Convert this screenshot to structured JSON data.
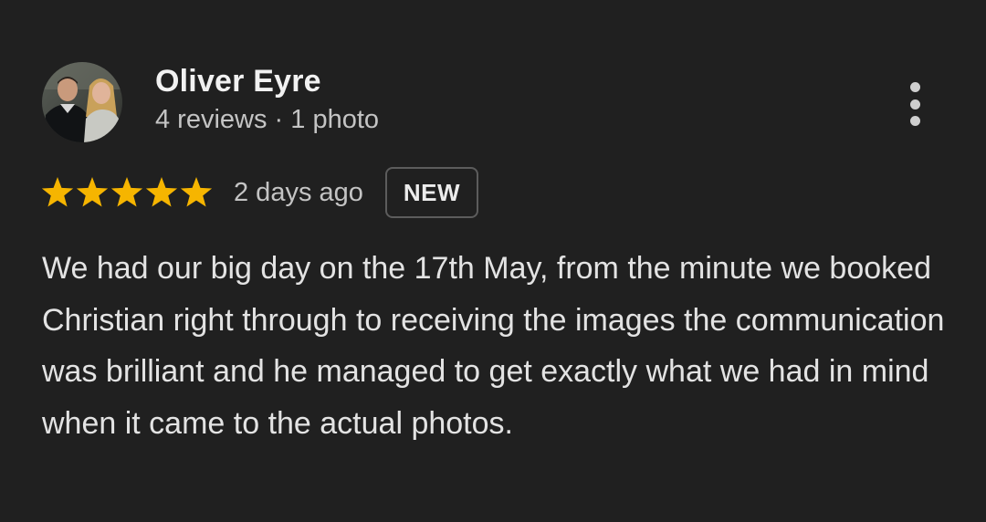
{
  "reviewer": {
    "name": "Oliver Eyre",
    "meta": "4 reviews · 1 photo",
    "avatar_icon": "profile-photo"
  },
  "rating": {
    "stars": 5,
    "max_stars": 5,
    "star_color": "#f6b500",
    "date": "2 days ago",
    "badge": "NEW"
  },
  "review": {
    "text": "We had our big day on the 17th May, from the minute we booked Christian right through to receiving the images the communication was brilliant and he managed to get exactly what we had in mind when it came to the actual photos."
  },
  "menu": {
    "icon": "more-vertical-icon"
  },
  "colors": {
    "background": "#202020",
    "text": "#e3e3e3",
    "secondary_text": "#c4c4c4"
  }
}
